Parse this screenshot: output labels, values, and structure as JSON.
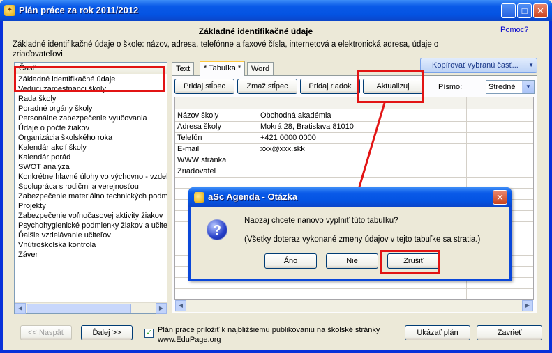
{
  "window": {
    "title": "Plán práce za rok 2011/2012",
    "min_glyph": "_",
    "max_glyph": "□",
    "close_glyph": "✕"
  },
  "header": {
    "section_title": "Základné identifikačné údaje",
    "help_link": "Pomoc?",
    "description": "Základné identifikačné údaje o škole: názov, adresa, telefónne a faxové čísla, internetová a elektronická adresa, údaje o zriaďovateľovi"
  },
  "part_list": {
    "header": "Časť",
    "items": [
      "Základné identifikačné údaje",
      "Vedúci zamestnanci školy",
      "Rada školy",
      "Poradné orgány školy",
      "Personálne zabezpečenie vyučovania",
      "Údaje o počte žiakov",
      "Organizácia školského roka",
      "Kalendár akcií školy",
      "Kalendár porád",
      "SWOT analýza",
      "Konkrétne hlavné úlohy vo výchovno - vzdelávacom procese",
      "Spolupráca s rodičmi a verejnosťou",
      "Zabezpečenie materiálno technických podmienok",
      "Projekty",
      "Zabezpečenie voľnočasovej aktivity žiakov",
      "Psychohygienické podmienky žiakov a učiteľov",
      "Ďalšie vzdelávanie učiteľov",
      "Vnútroškolská kontrola",
      "Záver"
    ]
  },
  "tabs": [
    {
      "label": "Text"
    },
    {
      "label": "* Tabuľka *"
    },
    {
      "label": "Word"
    }
  ],
  "toolbar": {
    "copy_button": "Kopírovať vybranú časť...",
    "add_column": "Pridaj stĺpec",
    "delete_column": "Zmaž stĺpec",
    "add_row": "Pridaj riadok",
    "update": "Aktualizuj",
    "font_label": "Písmo:",
    "font_value": "Stredné"
  },
  "table": {
    "rows": [
      {
        "label": "Názov školy",
        "value": "Obchodná akadémia"
      },
      {
        "label": "Adresa školy",
        "value": "Mokrá 28, Bratislava 81010"
      },
      {
        "label": "Telefón",
        "value": "+421 0000 0000"
      },
      {
        "label": "E-mail",
        "value": "xxx@xxx.skk"
      },
      {
        "label": "WWW stránka",
        "value": ""
      },
      {
        "label": "Zriaďovateľ",
        "value": ""
      }
    ]
  },
  "bottom": {
    "back_button": "<< Naspäť",
    "next_button": "Ďalej >>",
    "publish_text": "Plán práce priložiť k najbližšiemu publikovaniu na školské stránky www.EduPage.org",
    "show_plan_button": "Ukázať plán",
    "close_button": "Zavrieť"
  },
  "dialog": {
    "title": "aSc Agenda - Otázka",
    "message": "Naozaj chcete nanovo vyplniť túto tabuľku?",
    "detail": "(Všetky doteraz vykonané zmeny údajov v tejto tabuľke sa stratia.)",
    "yes_button": "Áno",
    "no_button": "Nie",
    "cancel_button": "Zrušiť",
    "question_glyph": "?"
  },
  "colors": {
    "annotation_red": "#e21414",
    "titlebar_blue": "#0453e2"
  }
}
